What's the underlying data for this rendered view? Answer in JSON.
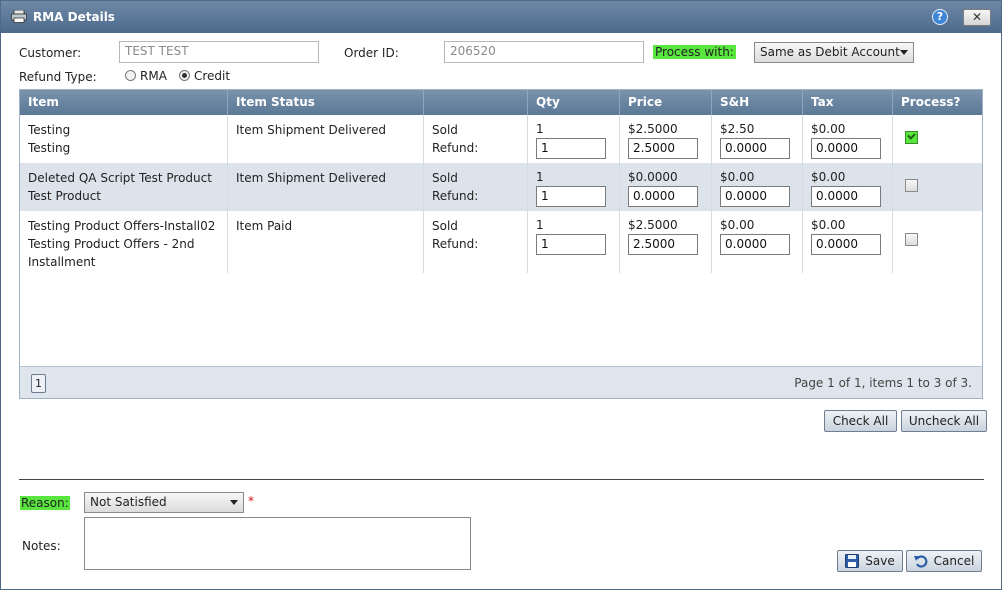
{
  "window": {
    "title": "RMA Details",
    "help": "?",
    "close": "✕"
  },
  "form": {
    "customer_label": "Customer:",
    "customer_value": "TEST TEST",
    "order_label": "Order ID:",
    "order_value": "206520",
    "process_label": "Process with:",
    "process_value": "Same as Debit Account",
    "refund_type_label": "Refund Type:",
    "refund_options": [
      "RMA",
      "Credit"
    ],
    "refund_selected": "Credit"
  },
  "grid": {
    "columns": [
      "Item",
      "Item Status",
      "",
      "Qty",
      "Price",
      "S&H",
      "Tax",
      "Process?"
    ],
    "sold_label": "Sold",
    "refund_label": "Refund:",
    "rows": [
      {
        "item_lines": [
          "Testing",
          "Testing"
        ],
        "status": "Item Shipment Delivered",
        "qty_sold": "1",
        "qty_refund": "1",
        "price_sold": "$2.5000",
        "price_refund": "2.5000",
        "sh_sold": "$2.50",
        "sh_refund": "0.0000",
        "tax_sold": "$0.00",
        "tax_refund": "0.0000",
        "process": true
      },
      {
        "item_lines": [
          "Deleted QA Script Test Product",
          "Test Product"
        ],
        "status": "Item Shipment Delivered",
        "qty_sold": "1",
        "qty_refund": "1",
        "price_sold": "$0.0000",
        "price_refund": "0.0000",
        "sh_sold": "$0.00",
        "sh_refund": "0.0000",
        "tax_sold": "$0.00",
        "tax_refund": "0.0000",
        "process": false
      },
      {
        "item_lines": [
          "Testing Product Offers-Install02",
          "Testing Product Offers - 2nd",
          "Installment"
        ],
        "status": "Item Paid",
        "qty_sold": "1",
        "qty_refund": "1",
        "price_sold": "$2.5000",
        "price_refund": "2.5000",
        "sh_sold": "$0.00",
        "sh_refund": "0.0000",
        "tax_sold": "$0.00",
        "tax_refund": "0.0000",
        "process": false
      }
    ],
    "pager": {
      "page_button": "1",
      "info": "Page 1 of 1, items 1 to 3 of 3."
    }
  },
  "actions": {
    "check_all": "Check All",
    "uncheck_all": "Uncheck All",
    "save": "Save",
    "cancel": "Cancel"
  },
  "bottom": {
    "reason_label": "Reason:",
    "reason_value": "Not Satisfied",
    "required_mark": "*",
    "notes_label": "Notes:",
    "notes_value": ""
  },
  "colors": {
    "highlight": "#58e63e",
    "header": "#5b7896",
    "alt_row": "#dde3ea"
  }
}
